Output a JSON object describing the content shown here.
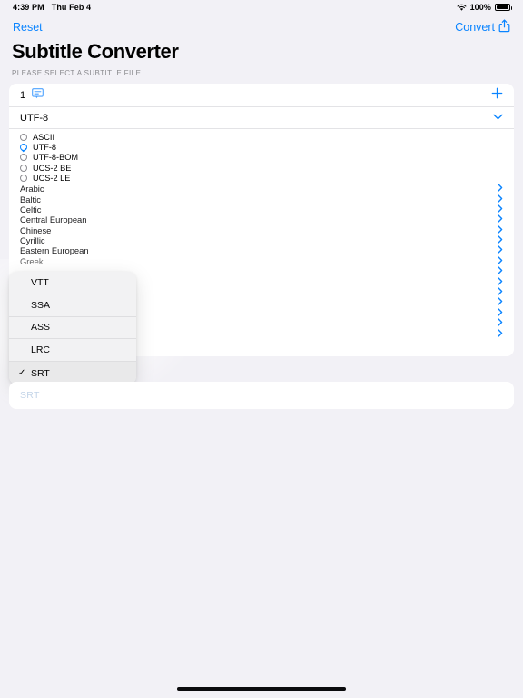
{
  "status_bar": {
    "time": "4:39 PM",
    "date": "Thu Feb 4",
    "battery_percent": "100%",
    "wifi_icon": "wifi-icon",
    "battery_icon": "battery-full-icon"
  },
  "nav_bar": {
    "reset_label": "Reset",
    "convert_label": "Convert",
    "share_icon": "share-export-icon"
  },
  "header": {
    "title": "Subtitle Converter",
    "section_header": "PLEASE SELECT A SUBTITLE FILE"
  },
  "file_row": {
    "count": "1",
    "subtitle_icon": "subtitle-captions-icon",
    "add_icon": "plus-icon"
  },
  "encoding_row": {
    "value": "UTF-8",
    "chevron_icon": "chevron-down-icon"
  },
  "encoding_options": [
    {
      "label": "ASCII",
      "selected": false
    },
    {
      "label": "UTF-8",
      "selected": true
    },
    {
      "label": "UTF-8-BOM",
      "selected": false
    },
    {
      "label": "UCS-2 BE",
      "selected": false
    },
    {
      "label": "UCS-2 LE",
      "selected": false
    }
  ],
  "encoding_categories": [
    {
      "label": "Arabic",
      "hidden": false
    },
    {
      "label": "Baltic",
      "hidden": false
    },
    {
      "label": "Celtic",
      "hidden": false
    },
    {
      "label": "Central European",
      "hidden": false
    },
    {
      "label": "Chinese",
      "hidden": false
    },
    {
      "label": "Cyrillic",
      "hidden": false
    },
    {
      "label": "Eastern European",
      "hidden": false
    },
    {
      "label": "Greek",
      "hidden": false
    },
    {
      "label": "",
      "hidden": true
    },
    {
      "label": "",
      "hidden": true
    },
    {
      "label": "",
      "hidden": true
    },
    {
      "label": "",
      "hidden": true
    },
    {
      "label": "",
      "hidden": true
    },
    {
      "label": "",
      "hidden": true
    },
    {
      "label": "",
      "hidden": true
    }
  ],
  "category_chevron_icon": "chevron-right-icon",
  "format_menu": {
    "items": [
      {
        "label": "VTT",
        "checked": false
      },
      {
        "label": "SSA",
        "checked": false
      },
      {
        "label": "ASS",
        "checked": false
      },
      {
        "label": "LRC",
        "checked": false
      },
      {
        "label": "SRT",
        "checked": true
      }
    ],
    "check_icon": "checkmark-icon"
  },
  "output_row": {
    "value": "SRT"
  },
  "colors": {
    "accent": "#0a84ff",
    "background": "#f2f1f6",
    "card": "#ffffff",
    "menu": "#f2f2f3",
    "muted_text": "#8a8a8e",
    "dimmed_value": "#c3d4e8"
  },
  "home_indicator": "home-indicator"
}
